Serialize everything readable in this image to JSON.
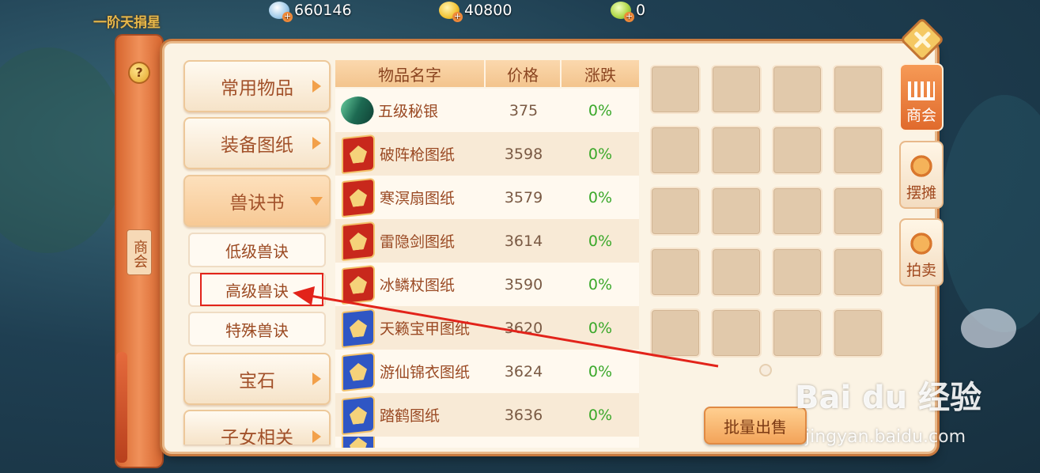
{
  "rank_label": "一阶天捐星",
  "currencies": {
    "silver": "660146",
    "gold": "40800",
    "jade": "0"
  },
  "left_rod": {
    "help_label": "?",
    "title": "商会"
  },
  "menu": {
    "categories": [
      {
        "label": "常用物品"
      },
      {
        "label": "装备图纸"
      },
      {
        "label": "兽诀书"
      },
      {
        "label": "宝石"
      },
      {
        "label": "子女相关"
      }
    ],
    "subcategories": [
      {
        "label": "低级兽诀"
      },
      {
        "label": "高级兽诀"
      },
      {
        "label": "特殊兽诀"
      }
    ]
  },
  "table": {
    "headers": {
      "name": "物品名字",
      "price": "价格",
      "change": "涨跌"
    },
    "rows": [
      {
        "icon": "ore-icon",
        "name": "五级秘银",
        "price": "375",
        "change": "0%"
      },
      {
        "icon": "red-book-icon",
        "name": "破阵枪图纸",
        "price": "3598",
        "change": "0%"
      },
      {
        "icon": "red-book-icon",
        "name": "寒溟扇图纸",
        "price": "3579",
        "change": "0%"
      },
      {
        "icon": "red-book-icon",
        "name": "雷隐剑图纸",
        "price": "3614",
        "change": "0%"
      },
      {
        "icon": "red-book-icon",
        "name": "冰鳞杖图纸",
        "price": "3590",
        "change": "0%"
      },
      {
        "icon": "blue-book-icon",
        "name": "天籁宝甲图纸",
        "price": "3620",
        "change": "0%"
      },
      {
        "icon": "blue-book-icon",
        "name": "游仙锦衣图纸",
        "price": "3624",
        "change": "0%"
      },
      {
        "icon": "blue-book-icon",
        "name": "踏鹤图纸",
        "price": "3636",
        "change": "0%"
      }
    ]
  },
  "inventory": {
    "bulk_sell_label": "批量出售"
  },
  "right_tabs": [
    {
      "label": "商会",
      "active": true
    },
    {
      "label": "摆摊",
      "active": false
    },
    {
      "label": "拍卖",
      "active": false
    }
  ],
  "watermark": {
    "brand": "Bai du 经验",
    "url": "jingyan.baidu.com"
  },
  "colors": {
    "accent": "#e06a2c",
    "change_up": "#3aa82a",
    "annotation": "#e2231a"
  }
}
